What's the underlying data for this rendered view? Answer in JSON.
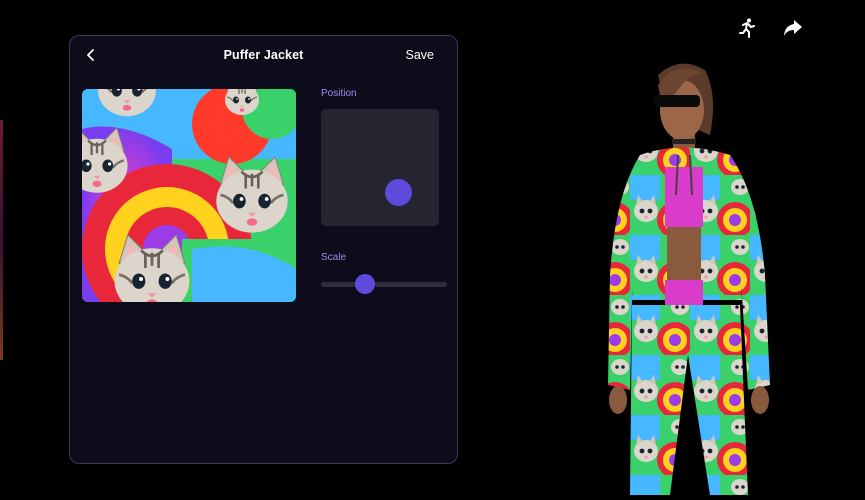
{
  "editor": {
    "title": "Puffer Jacket",
    "save_label": "Save",
    "position_label": "Position",
    "scale_label": "Scale"
  },
  "controls": {
    "scale_fraction": 0.34
  },
  "icons": {
    "back": "chevron-left-icon",
    "pose": "pose-figure-icon",
    "share": "share-arrow-icon"
  },
  "colors": {
    "accent": "#5e4bdc",
    "label": "#9b8ff2",
    "panel_bg": "#0c0c1b",
    "panel_border": "#3a3a5c"
  }
}
